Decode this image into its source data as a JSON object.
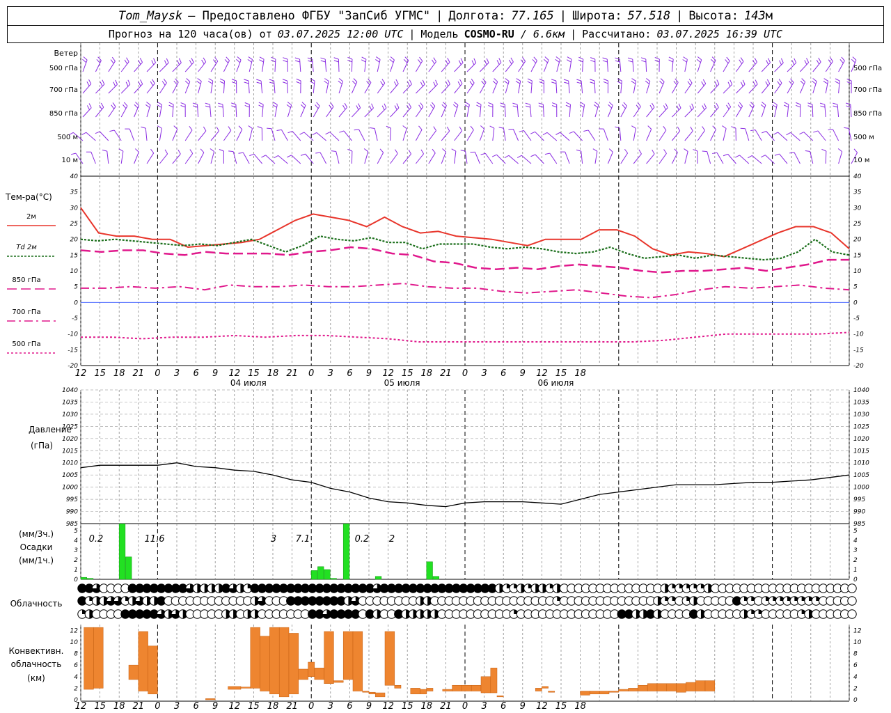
{
  "header": {
    "station": "Tom_Maysk",
    "provider": "– Предоставлено ФГБУ \"ЗапСиб УГМС\"",
    "lon_label": "Долгота:",
    "lon": "77.165",
    "lat_label": "Широта:",
    "lat": "57.518",
    "alt_label": "Высота:",
    "alt": "143",
    "alt_unit": "м",
    "forecast_label": "Прогноз на 120 часа(ов) от",
    "forecast_from": "03.07.2025 12:00 UTC",
    "model_label": "Модель",
    "model": "COSMO-RU",
    "model_res": "/ 6.6км",
    "calc_label": "Рассчитано:",
    "calc_time": "03.07.2025 16:39 UTC"
  },
  "wind_panel": {
    "title": "Ветер",
    "levels": [
      "500 гПа",
      "700 гПа",
      "850 гПа",
      "500 м",
      "10 м"
    ],
    "barb_color": "#8a2be2"
  },
  "temp_panel": {
    "title": "Тем-ра(°C)",
    "legend": [
      {
        "label": "2м",
        "italic": false
      },
      {
        "label": "Td 2м",
        "italic": true
      },
      {
        "label": "850 гПа",
        "italic": false
      },
      {
        "label": "700 гПа",
        "italic": false
      },
      {
        "label": "500 гПа",
        "italic": false
      }
    ]
  },
  "time_axis": {
    "hour_labels": [
      "12",
      "15",
      "18",
      "21",
      "0",
      "3",
      "6",
      "9",
      "12",
      "15",
      "18",
      "21",
      "0",
      "3",
      "6",
      "9",
      "12",
      "15",
      "18",
      "21",
      "0",
      "3",
      "6",
      "9",
      "12",
      "15",
      "18"
    ],
    "dates": [
      "04 июля",
      "05 июля",
      "06 июля"
    ]
  },
  "pressure_panel": {
    "title_line1": "Давление",
    "title_line2": "(гПа)"
  },
  "precip_panel": {
    "title_line1": "(мм/3ч.)",
    "title_line2": "Осадки",
    "title_line3": "(мм/1ч.)",
    "totals": [
      "0.2",
      "11.6",
      "3",
      "7.1",
      "0.2",
      "2"
    ]
  },
  "cloud_panel": {
    "title": "Облачность",
    "rows": [
      "443000044444444322224321444444444444444443444444444444444421121221200000000000000211111200000000000000000000",
      "412233123224000000000000230004444444423000000002200000000000000000100000000000002110120000041101111111100000",
      "120000444443232000002202200000004434444042004222220000000000100000000000000442242000042000002110000012000000"
    ]
  },
  "conv_panel": {
    "title_line1": "Конвективн.",
    "title_line2": "облачность",
    "title_line3": "(км)"
  },
  "chart_data": [
    {
      "type": "line",
      "title": "Тем-ра(°C)",
      "xlabel": "",
      "ylabel": "Тем-ра(°C)",
      "x_unit": "hours from 03.07.2025 12:00 UTC",
      "ylim": [
        -20,
        40
      ],
      "x": [
        0,
        3,
        6,
        9,
        12,
        15,
        18,
        21,
        24,
        27,
        30,
        33,
        36,
        39,
        42,
        45,
        48,
        51,
        54,
        57,
        60,
        63,
        66,
        69,
        72,
        75,
        78,
        81,
        84,
        87,
        90,
        93,
        96,
        99,
        102,
        105,
        108,
        111,
        114,
        117,
        120
      ],
      "series": [
        {
          "name": "2м",
          "color": "#e8352b",
          "values": [
            30,
            22,
            21,
            21,
            20,
            20,
            17.5,
            18,
            18.5,
            19,
            20,
            23,
            26,
            28,
            27,
            26,
            24,
            27,
            24,
            22,
            22.5,
            21,
            20.5,
            20,
            19,
            18,
            20,
            20,
            20,
            23,
            23,
            21,
            17,
            15,
            16,
            15.5,
            14.5,
            17,
            19.5,
            22,
            24,
            24,
            22,
            17
          ]
        },
        {
          "name": "Td 2м",
          "color": "#1a6e1a",
          "values": [
            20,
            19.5,
            20,
            19.5,
            19,
            18.5,
            18,
            18.5,
            18,
            19,
            20,
            18,
            16,
            18,
            21,
            20,
            19.5,
            20.5,
            19,
            19,
            17,
            18.5,
            18.5,
            18.5,
            17.5,
            17,
            17.5,
            17,
            16,
            15.5,
            16,
            17.5,
            15.5,
            14,
            14.5,
            15,
            14,
            15,
            14.5,
            14,
            13.5,
            14,
            16,
            20,
            16,
            15
          ]
        },
        {
          "name": "850 гПа",
          "color": "#e0188c",
          "values": [
            16.5,
            16,
            16.5,
            16.5,
            15.5,
            15,
            16,
            15.5,
            15.5,
            15.5,
            15,
            16,
            16.5,
            17.5,
            17,
            15.5,
            15,
            13,
            12.5,
            11,
            10.5,
            11,
            10.5,
            11.5,
            12,
            11.5,
            11,
            10,
            9.5,
            10,
            10,
            10.5,
            11,
            10,
            11,
            12,
            13.5,
            13.5
          ]
        },
        {
          "name": "700 гПа",
          "color": "#e0188c",
          "values": [
            4.5,
            4.5,
            5,
            4.5,
            5,
            4,
            5.5,
            5,
            5,
            5.5,
            5,
            5,
            5.5,
            6,
            5,
            4.5,
            4.5,
            3.5,
            3,
            3.5,
            4,
            3,
            2,
            1.5,
            2.5,
            4,
            5,
            4.5,
            5,
            5.5,
            4.5,
            4
          ]
        },
        {
          "name": "500 гПа",
          "color": "#e0188c",
          "values": [
            -11,
            -11,
            -11.5,
            -11,
            -11,
            -10.5,
            -11,
            -10.5,
            -10.5,
            -11,
            -11.5,
            -12.5,
            -12.5,
            -12.5,
            -12.5,
            -12.5,
            -12.5,
            -12.5,
            -12.5,
            -12,
            -11,
            -10,
            -10,
            -10,
            -10,
            -9.5
          ]
        }
      ]
    },
    {
      "type": "line",
      "title": "Давление (гПа)",
      "xlabel": "",
      "ylabel": "Давление (гПа)",
      "x_unit": "hours from 03.07.2025 12:00 UTC",
      "ylim": [
        985,
        1040
      ],
      "series": [
        {
          "name": "",
          "color": "#000000",
          "values": [
            1008,
            1009,
            1009,
            1009,
            1009,
            1010,
            1008.5,
            1008,
            1007,
            1006.5,
            1005,
            1003,
            1002,
            999.5,
            998,
            995.5,
            994,
            993.5,
            992.5,
            992,
            993.5,
            994,
            994,
            994,
            993.5,
            993,
            995,
            997,
            998,
            999,
            1000,
            1001,
            1001,
            1001,
            1001.5,
            1002,
            1002,
            1002.5,
            1003,
            1004,
            1005
          ]
        }
      ]
    },
    {
      "type": "bar",
      "title": "Осадки",
      "xlabel": "",
      "ylabel": "Осадки (мм/3ч.) (мм/1ч.)",
      "x_unit": "hours from 03.07.2025 12:00 UTC",
      "ylim": [
        0,
        5
      ],
      "x": [
        0,
        1,
        2,
        3,
        4,
        5,
        6,
        7,
        8,
        9,
        10,
        11,
        12,
        13,
        14,
        15,
        16,
        17,
        18,
        19,
        20,
        21,
        22,
        23,
        24,
        25,
        26,
        27,
        28,
        29,
        30,
        31,
        32,
        33,
        34,
        35,
        36,
        37,
        38,
        39,
        40,
        41,
        42,
        43,
        44,
        45,
        46,
        47,
        48,
        49,
        50,
        51,
        52,
        53,
        54,
        55,
        56,
        57,
        58,
        59,
        60,
        61,
        62,
        63,
        64,
        65,
        66,
        67,
        68,
        69,
        70,
        71,
        72,
        73,
        74,
        75,
        76,
        77,
        78,
        79,
        80,
        81,
        82,
        83,
        84,
        85,
        86,
        87,
        88,
        89,
        90,
        91,
        92,
        93,
        94,
        95,
        96,
        97,
        98,
        99,
        100,
        101,
        102,
        103,
        104,
        105,
        106,
        107,
        108,
        109,
        110,
        111,
        112,
        113,
        114,
        115,
        116,
        117,
        118,
        119,
        120
      ],
      "values": [
        0.2,
        0.1,
        0,
        0,
        0,
        0,
        6.2,
        2.3,
        0,
        0,
        0,
        0,
        0,
        0,
        0,
        0,
        0,
        0,
        0,
        0,
        0,
        0,
        0,
        0,
        0,
        0,
        0,
        0,
        0,
        0,
        0,
        0,
        0,
        0,
        0,
        0,
        0.9,
        1.3,
        1.0,
        0.1,
        0,
        5.9,
        0,
        0,
        0,
        0,
        0.3,
        0,
        0,
        0,
        0,
        0,
        0,
        0,
        1.8,
        0.3,
        0,
        0,
        0,
        0,
        0,
        0,
        0,
        0,
        0,
        0,
        0,
        0,
        0,
        0,
        0,
        0,
        0,
        0,
        0,
        0,
        0,
        0,
        0,
        0,
        0,
        0,
        0,
        0,
        0,
        0,
        0,
        0,
        0,
        0,
        0,
        0,
        0,
        0,
        0,
        0,
        0,
        0,
        0,
        0,
        0,
        0,
        0,
        0,
        0,
        0,
        0,
        0,
        0,
        0,
        0,
        0,
        0,
        0,
        0,
        0,
        0,
        0,
        0,
        0,
        0
      ]
    },
    {
      "type": "bar",
      "title": "Конвективн. облачность",
      "xlabel": "",
      "ylabel": "Конвективн. облачность (км)",
      "x_unit": "hours from 03.07.2025 12:00 UTC",
      "ylim": [
        0,
        13
      ],
      "bars": [
        {
          "x0": 0.5,
          "x1": 2,
          "base": 1.8,
          "top": 12.5
        },
        {
          "x0": 2,
          "x1": 3.5,
          "base": 2,
          "top": 12.5
        },
        {
          "x0": 7.5,
          "x1": 9,
          "base": 3.5,
          "top": 6
        },
        {
          "x0": 9,
          "x1": 10.5,
          "base": 1.5,
          "top": 11.8
        },
        {
          "x0": 10.5,
          "x1": 12,
          "base": 1,
          "top": 9.3
        },
        {
          "x0": 19.5,
          "x1": 21,
          "base": 0,
          "top": 0.2
        },
        {
          "x0": 23,
          "x1": 25,
          "base": 1.8,
          "top": 2.3
        },
        {
          "x0": 25,
          "x1": 26.5,
          "base": 2,
          "top": 2.2
        },
        {
          "x0": 26.5,
          "x1": 28,
          "base": 2,
          "top": 12.5
        },
        {
          "x0": 28,
          "x1": 29.5,
          "base": 1.5,
          "top": 11
        },
        {
          "x0": 29.5,
          "x1": 31,
          "base": 1,
          "top": 12.5
        },
        {
          "x0": 31,
          "x1": 32.5,
          "base": 0.5,
          "top": 12.5
        },
        {
          "x0": 32.5,
          "x1": 34,
          "base": 1,
          "top": 11.5
        },
        {
          "x0": 34,
          "x1": 35.5,
          "base": 3.5,
          "top": 5.3
        },
        {
          "x0": 35.5,
          "x1": 36.5,
          "base": 4,
          "top": 6.5
        },
        {
          "x0": 36.5,
          "x1": 38,
          "base": 3.5,
          "top": 5.5
        },
        {
          "x0": 38,
          "x1": 39.5,
          "base": 2.8,
          "top": 11.8
        },
        {
          "x0": 39.5,
          "x1": 41,
          "base": 3,
          "top": 3.3
        },
        {
          "x0": 41,
          "x1": 42.5,
          "base": 3.5,
          "top": 11.8
        },
        {
          "x0": 42.5,
          "x1": 44,
          "base": 1.5,
          "top": 11.8
        },
        {
          "x0": 44,
          "x1": 45,
          "base": 1.3,
          "top": 1.5
        },
        {
          "x0": 45,
          "x1": 46,
          "base": 1,
          "top": 1.3
        },
        {
          "x0": 46,
          "x1": 47.5,
          "base": 0.5,
          "top": 1.2
        },
        {
          "x0": 47.5,
          "x1": 49,
          "base": 2.5,
          "top": 11.8
        },
        {
          "x0": 49,
          "x1": 50,
          "base": 2,
          "top": 2.5
        },
        {
          "x0": 51.5,
          "x1": 53,
          "base": 1,
          "top": 2
        },
        {
          "x0": 53,
          "x1": 54,
          "base": 1,
          "top": 1.8
        },
        {
          "x0": 54,
          "x1": 55,
          "base": 1.5,
          "top": 2
        },
        {
          "x0": 56.5,
          "x1": 58,
          "base": 1.5,
          "top": 1.8
        },
        {
          "x0": 58,
          "x1": 59.5,
          "base": 1.5,
          "top": 2.5
        },
        {
          "x0": 59.5,
          "x1": 61,
          "base": 1.5,
          "top": 2.5
        },
        {
          "x0": 61,
          "x1": 62.5,
          "base": 1.5,
          "top": 2.5
        },
        {
          "x0": 62.5,
          "x1": 64,
          "base": 1.2,
          "top": 4
        },
        {
          "x0": 64,
          "x1": 65,
          "base": 1.2,
          "top": 5.5
        },
        {
          "x0": 65,
          "x1": 66,
          "base": 0.5,
          "top": 0.7
        },
        {
          "x0": 71,
          "x1": 72,
          "base": 1.5,
          "top": 2
        },
        {
          "x0": 72,
          "x1": 73,
          "base": 2,
          "top": 2.3
        },
        {
          "x0": 73,
          "x1": 74,
          "base": 1.3,
          "top": 1.5
        },
        {
          "x0": 78,
          "x1": 79.5,
          "base": 0.8,
          "top": 1.5
        },
        {
          "x0": 79.5,
          "x1": 81,
          "base": 1,
          "top": 1.5
        },
        {
          "x0": 81,
          "x1": 82.5,
          "base": 1,
          "top": 1.5
        },
        {
          "x0": 82.5,
          "x1": 84,
          "base": 1.3,
          "top": 1.5
        },
        {
          "x0": 84,
          "x1": 85.5,
          "base": 1.5,
          "top": 1.8
        },
        {
          "x0": 85.5,
          "x1": 87,
          "base": 1.5,
          "top": 2
        },
        {
          "x0": 87,
          "x1": 88.5,
          "base": 1.5,
          "top": 2.5
        },
        {
          "x0": 88.5,
          "x1": 90,
          "base": 1.5,
          "top": 2.8
        },
        {
          "x0": 90,
          "x1": 91.5,
          "base": 1.5,
          "top": 2.8
        },
        {
          "x0": 91.5,
          "x1": 93,
          "base": 1.5,
          "top": 2.8
        },
        {
          "x0": 93,
          "x1": 94.5,
          "base": 1.3,
          "top": 2.8
        },
        {
          "x0": 94.5,
          "x1": 96,
          "base": 1.5,
          "top": 3
        },
        {
          "x0": 96,
          "x1": 97.5,
          "base": 1.5,
          "top": 3.3
        },
        {
          "x0": 97.5,
          "x1": 99,
          "base": 1.5,
          "top": 3.3
        }
      ]
    }
  ]
}
